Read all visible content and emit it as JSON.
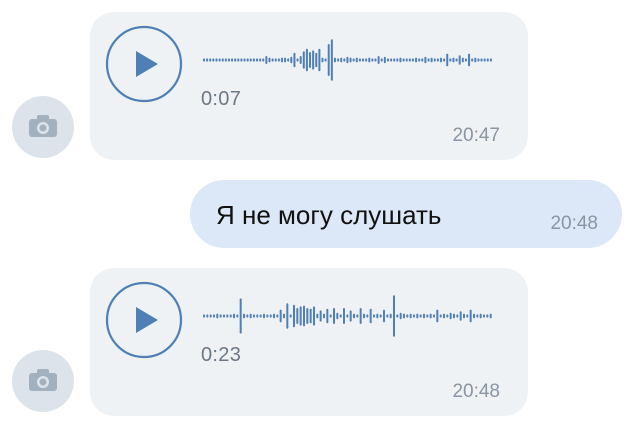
{
  "colors": {
    "accent": "#4f7fb4",
    "incoming_bubble": "#eff2f5",
    "outgoing_bubble": "#dce8f7",
    "avatar": "#dce3ea"
  },
  "messages": [
    {
      "type": "voice",
      "direction": "incoming",
      "duration": "0:07",
      "time": "20:47",
      "avatar_icon": "camera-icon",
      "play_icon": "play-icon",
      "waveform": [
        2,
        2,
        2,
        2,
        2,
        2,
        2,
        2,
        2,
        2,
        2,
        2,
        2,
        2,
        2,
        2,
        2,
        2,
        2,
        2,
        5,
        3,
        2,
        2,
        2,
        3,
        3,
        2,
        4,
        9,
        2,
        5,
        11,
        14,
        10,
        12,
        9,
        14,
        3,
        2,
        20,
        26,
        3,
        2,
        3,
        2,
        4,
        3,
        2,
        3,
        2,
        2,
        2,
        3,
        2,
        2,
        5,
        2,
        4,
        2,
        2,
        2,
        2,
        3,
        2,
        2,
        2,
        2,
        3,
        2,
        2,
        4,
        2,
        3,
        2,
        2,
        3,
        2,
        8,
        2,
        3,
        2,
        6,
        3,
        2,
        8,
        2,
        3,
        2,
        2,
        2,
        2,
        2
      ]
    },
    {
      "type": "text",
      "direction": "outgoing",
      "text": "Я не могу слушать",
      "time": "20:48"
    },
    {
      "type": "voice",
      "direction": "incoming",
      "duration": "0:23",
      "time": "20:48",
      "avatar_icon": "camera-icon",
      "play_icon": "play-icon",
      "waveform": [
        2,
        2,
        2,
        2,
        3,
        2,
        2,
        2,
        2,
        3,
        2,
        22,
        3,
        2,
        3,
        2,
        2,
        2,
        3,
        2,
        2,
        3,
        2,
        8,
        3,
        16,
        2,
        14,
        10,
        12,
        13,
        10,
        9,
        12,
        3,
        7,
        3,
        9,
        2,
        10,
        4,
        2,
        10,
        2,
        7,
        3,
        2,
        10,
        3,
        2,
        9,
        2,
        3,
        2,
        8,
        2,
        3,
        26,
        2,
        4,
        3,
        2,
        3,
        2,
        3,
        2,
        3,
        2,
        3,
        2,
        8,
        2,
        3,
        2,
        4,
        3,
        2,
        6,
        3,
        2,
        8,
        3,
        2,
        3,
        2,
        2,
        3
      ]
    }
  ]
}
